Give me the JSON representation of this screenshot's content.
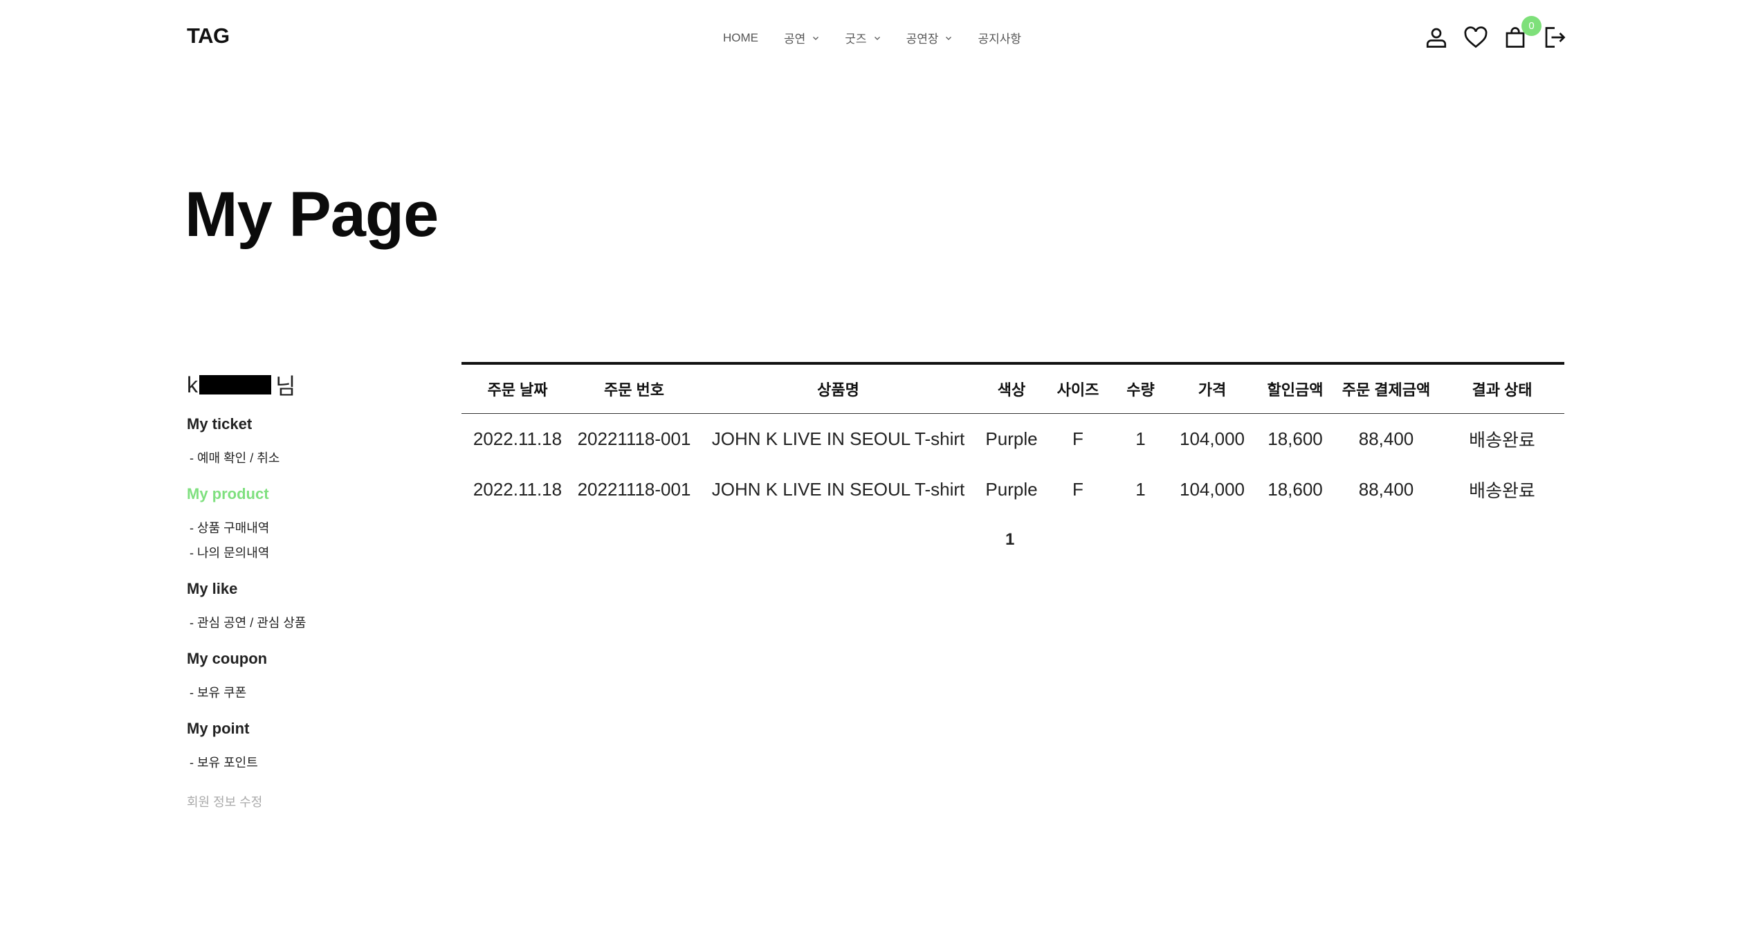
{
  "header": {
    "logo": "TAG",
    "nav": [
      {
        "label": "HOME",
        "dropdown": false
      },
      {
        "label": "공연",
        "dropdown": true
      },
      {
        "label": "굿즈",
        "dropdown": true
      },
      {
        "label": "공연장",
        "dropdown": true
      },
      {
        "label": "공지사항",
        "dropdown": false
      }
    ],
    "cart_count": "0",
    "icons": [
      "user-icon",
      "heart-icon",
      "cart-icon",
      "logout-icon"
    ],
    "badge_color": "#7ee07a"
  },
  "page_title": "My Page",
  "sidebar": {
    "user_prefix": "k",
    "user_suffix": "님",
    "sections": [
      {
        "title": "My ticket",
        "active": false,
        "items": [
          "- 예매 확인 / 취소"
        ]
      },
      {
        "title": "My product",
        "active": true,
        "items": [
          "- 상품 구매내역",
          "- 나의 문의내역"
        ]
      },
      {
        "title": "My like",
        "active": false,
        "items": [
          "- 관심 공연 / 관심 상품"
        ]
      },
      {
        "title": "My coupon",
        "active": false,
        "items": [
          "- 보유 쿠폰"
        ]
      },
      {
        "title": "My point",
        "active": false,
        "items": [
          "- 보유 포인트"
        ]
      }
    ],
    "edit_link": "회원 정보 수정",
    "active_color": "#7fe07f"
  },
  "orders": {
    "columns": [
      "주문 날짜",
      "주문 번호",
      "상품명",
      "색상",
      "사이즈",
      "수량",
      "가격",
      "할인금액",
      "주문 결제금액",
      "결과 상태"
    ],
    "rows": [
      [
        "2022.11.18",
        "20221118-001",
        "JOHN K LIVE IN SEOUL T-shirt",
        "Purple",
        "F",
        "1",
        "104,000",
        "18,600",
        "88,400",
        "배송완료"
      ],
      [
        "2022.11.18",
        "20221118-001",
        "JOHN K LIVE IN SEOUL T-shirt",
        "Purple",
        "F",
        "1",
        "104,000",
        "18,600",
        "88,400",
        "배송완료"
      ]
    ]
  },
  "pagination": {
    "current": "1"
  }
}
